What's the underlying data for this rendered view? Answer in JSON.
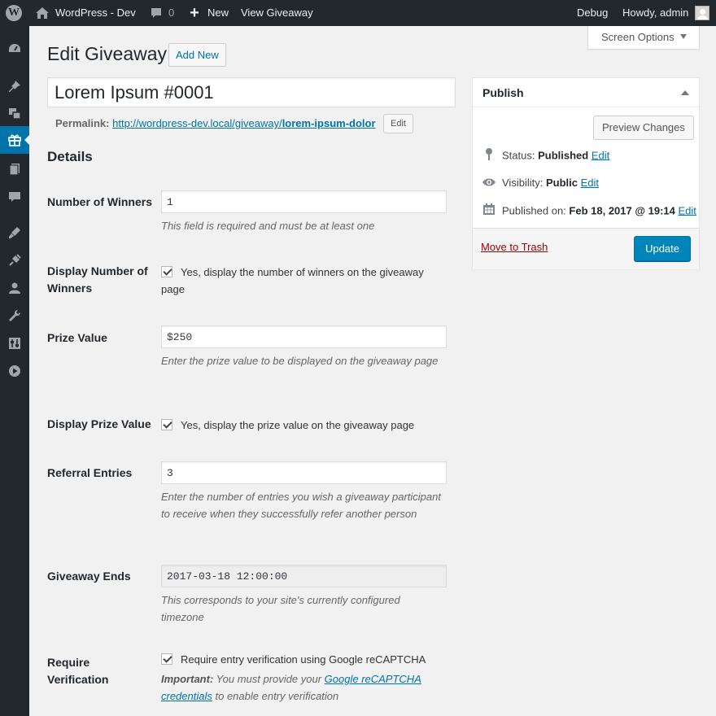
{
  "admin_bar": {
    "site_name": "WordPress - Dev",
    "comments_count": "0",
    "new_label": "New",
    "view_label": "View Giveaway",
    "debug_label": "Debug",
    "howdy": "Howdy, admin"
  },
  "sidebar": {
    "items": [
      {
        "name": "dashboard-icon"
      },
      {
        "name": "posts-icon"
      },
      {
        "name": "media-icon"
      },
      {
        "name": "giveaways-icon",
        "current": true
      },
      {
        "name": "pages-icon"
      },
      {
        "name": "comments-icon"
      },
      {
        "name": "appearance-icon"
      },
      {
        "name": "plugins-icon"
      },
      {
        "name": "users-icon"
      },
      {
        "name": "tools-icon"
      },
      {
        "name": "settings-icon"
      },
      {
        "name": "media-player-icon"
      }
    ]
  },
  "screen_options": "Screen Options",
  "page": {
    "title": "Edit Giveaway",
    "add_new": "Add New",
    "post_title": "Lorem Ipsum #0001",
    "permalink_label": "Permalink:",
    "permalink_base": "http://wordpress-dev.local/giveaway/",
    "permalink_slug": "lorem-ipsum-dolor",
    "permalink_edit": "Edit"
  },
  "details": {
    "heading": "Details",
    "winners_label": "Number of Winners",
    "winners_value": "1",
    "winners_desc": "This field is required and must be at least one",
    "display_winners_label": "Display Number of Winners",
    "display_winners_check": "Yes, display the number of winners on the giveaway page",
    "prize_label": "Prize Value",
    "prize_value": "$250",
    "prize_desc": "Enter the prize value to be displayed on the giveaway page",
    "display_prize_label": "Display Prize Value",
    "display_prize_check": "Yes, display the prize value on the giveaway page",
    "referral_label": "Referral Entries",
    "referral_value": "3",
    "referral_desc": "Enter the number of entries you wish a giveaway participant to receive when they successfully refer another person",
    "ends_label": "Giveaway Ends",
    "ends_value": "2017-03-18 12:00:00",
    "ends_desc": "This corresponds to your site's currently configured timezone",
    "verify_label": "Require Verification",
    "verify_check": "Require entry verification using Google reCAPTCHA",
    "verify_important": "Important:",
    "verify_desc_pre": "You must provide your",
    "verify_link": "Google reCAPTCHA credentials",
    "verify_desc_post": "to enable entry verification"
  },
  "publish": {
    "heading": "Publish",
    "preview": "Preview Changes",
    "status_label": "Status:",
    "status_value": "Published",
    "visibility_label": "Visibility:",
    "visibility_value": "Public",
    "published_label": "Published on:",
    "published_value": "Feb 18, 2017 @ 19:14",
    "edit": "Edit",
    "trash": "Move to Trash",
    "update": "Update"
  },
  "colors": {
    "admin_bar_bg": "#23282d",
    "accent": "#0073aa",
    "primary_button": "#0085ba",
    "trash": "#a00000"
  }
}
